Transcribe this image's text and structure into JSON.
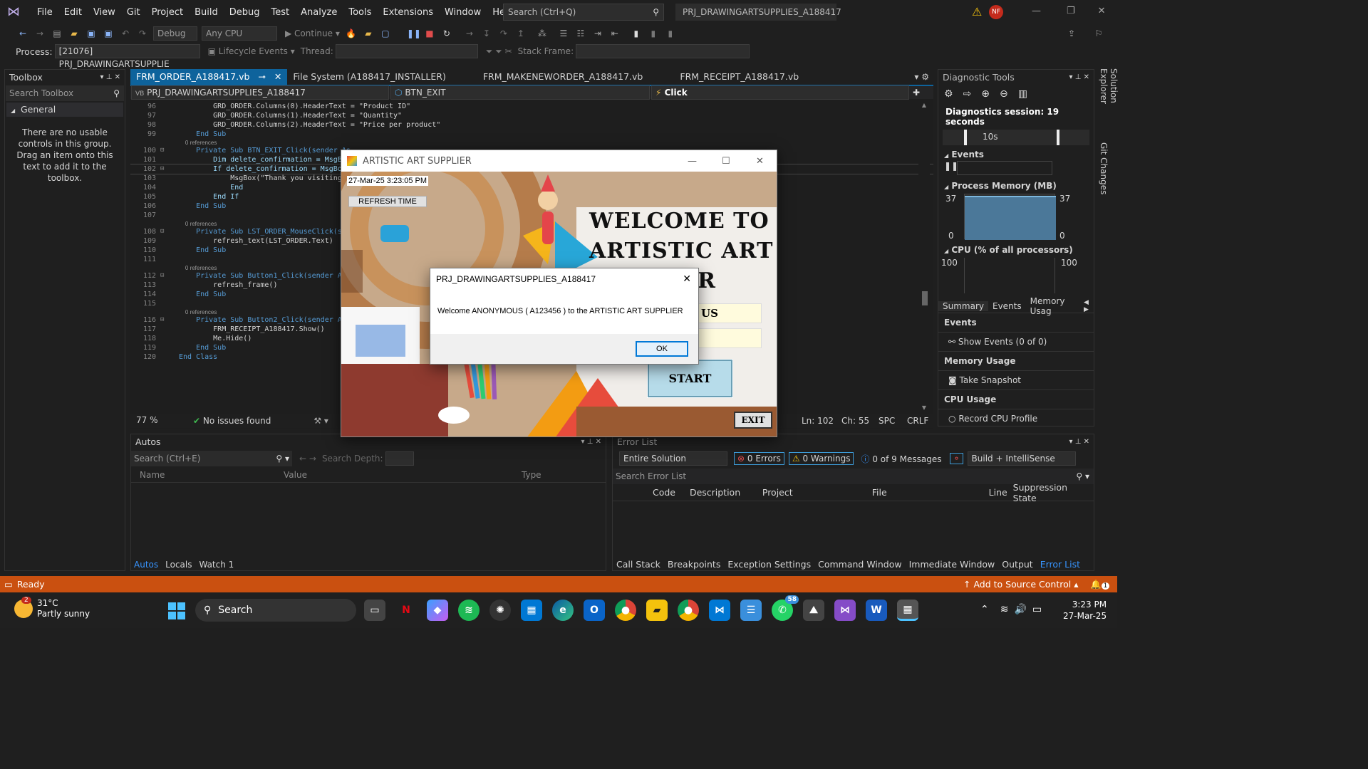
{
  "menu": [
    "File",
    "Edit",
    "View",
    "Git",
    "Project",
    "Build",
    "Debug",
    "Test",
    "Analyze",
    "Tools",
    "Extensions",
    "Window",
    "Help"
  ],
  "search": {
    "placeholder": "Search (Ctrl+Q)"
  },
  "solution_title": "PRJ_DRAWINGARTSUPPLIES_A188417",
  "user_initials": "NF",
  "toolbar": {
    "config": "Debug",
    "platform": "Any CPU",
    "continue": "Continue"
  },
  "toolbar2": {
    "process_label": "Process:",
    "process_value": "[21076] PRJ_DRAWINGARTSUPPLIE",
    "lifecycle": "Lifecycle Events",
    "thread": "Thread:",
    "stackframe": "Stack Frame:"
  },
  "toolbox": {
    "title": "Toolbox",
    "search": "Search Toolbox",
    "group": "General",
    "empty": "There are no usable controls in this group. Drag an item onto this text to add it to the toolbox."
  },
  "tabs": [
    "FRM_ORDER_A188417.vb",
    "File System (A188417_INSTALLER)",
    "FRM_MAKENEWORDER_A188417.vb",
    "FRM_RECEIPT_A188417.vb"
  ],
  "nav": {
    "project": "PRJ_DRAWINGARTSUPPLIES_A188417",
    "object": "BTN_EXIT",
    "event": "Click"
  },
  "code": [
    {
      "n": "96",
      "t": "        GRD_ORDER.Columns(0).HeaderText = \"Product ID\""
    },
    {
      "n": "97",
      "t": "        GRD_ORDER.Columns(1).HeaderText = \"Quantity\""
    },
    {
      "n": "98",
      "t": "        GRD_ORDER.Columns(2).HeaderText = \"Price per product\""
    },
    {
      "n": "99",
      "t": "    End Sub"
    },
    {
      "n": "",
      "t": "    0 references",
      "ref": true
    },
    {
      "n": "100",
      "t": "    Private Sub BTN_EXIT_Click(sender As"
    },
    {
      "n": "101",
      "t": "        Dim delete_confirmation = MsgBox"
    },
    {
      "n": "102",
      "t": "        If delete_confirmation = MsgBoxR"
    },
    {
      "n": "103",
      "t": "            MsgBox(\"Thank you visiting A"
    },
    {
      "n": "104",
      "t": "            End"
    },
    {
      "n": "105",
      "t": "        End If"
    },
    {
      "n": "106",
      "t": "    End Sub"
    },
    {
      "n": "107",
      "t": ""
    },
    {
      "n": "",
      "t": "    0 references",
      "ref": true
    },
    {
      "n": "108",
      "t": "    Private Sub LST_ORDER_MouseClick(ser"
    },
    {
      "n": "109",
      "t": "        refresh_text(LST_ORDER.Text)"
    },
    {
      "n": "110",
      "t": "    End Sub"
    },
    {
      "n": "111",
      "t": ""
    },
    {
      "n": "",
      "t": "    0 references",
      "ref": true
    },
    {
      "n": "112",
      "t": "    Private Sub Button1_Click(sender As"
    },
    {
      "n": "113",
      "t": "        refresh_frame()"
    },
    {
      "n": "114",
      "t": "    End Sub"
    },
    {
      "n": "115",
      "t": ""
    },
    {
      "n": "",
      "t": "    0 references",
      "ref": true
    },
    {
      "n": "116",
      "t": "    Private Sub Button2_Click(sender As"
    },
    {
      "n": "117",
      "t": "        FRM_RECEIPT_A188417.Show()"
    },
    {
      "n": "118",
      "t": "        Me.Hide()"
    },
    {
      "n": "119",
      "t": "    End Sub"
    },
    {
      "n": "120",
      "t": "End Class"
    }
  ],
  "editor_status": {
    "zoom": "77 %",
    "issues": "No issues found",
    "ln": "Ln: 102",
    "ch": "Ch: 55",
    "spc": "SPC",
    "crlf": "CRLF"
  },
  "diag": {
    "title": "Diagnostic Tools",
    "session": "Diagnostics session: 19 seconds",
    "time_tick": "10s",
    "events": "Events",
    "memory": "Process Memory (MB)",
    "mem_max": "37",
    "mem_min": "0",
    "cpu": "CPU (% of all processors)",
    "cpu_max": "100",
    "tabs": [
      "Summary",
      "Events",
      "Memory Usag"
    ],
    "events_h": "Events",
    "show_events": "Show Events (0 of 0)",
    "mem_h": "Memory Usage",
    "snapshot": "Take Snapshot",
    "cpu_h": "CPU Usage",
    "record": "Record CPU Profile"
  },
  "side_tabs": [
    "Solution Explorer",
    "Git Changes"
  ],
  "autos": {
    "title": "Autos",
    "search": "Search (Ctrl+E)",
    "depth": "Search Depth:",
    "cols": [
      "Name",
      "Value",
      "Type"
    ],
    "tabs": [
      "Autos",
      "Locals",
      "Watch 1"
    ]
  },
  "errlist": {
    "title": "Error List",
    "scope": "Entire Solution",
    "errors": "0 Errors",
    "warnings": "0 Warnings",
    "messages": "0 of 9 Messages",
    "build": "Build + IntelliSense",
    "search": "Search Error List",
    "cols": [
      "Code",
      "Description",
      "Project",
      "File",
      "Line",
      "Suppression State"
    ],
    "bottom_tabs": [
      "Call Stack",
      "Breakpoints",
      "Exception Settings",
      "Command Window",
      "Immediate Window",
      "Output",
      "Error List"
    ]
  },
  "status": {
    "ready": "Ready",
    "source": "Add to Source Control"
  },
  "app": {
    "title": "ARTISTIC ART SUPPLIER",
    "datetime": "27-Mar-25 3:23:05 PM",
    "refresh": "REFRESH TIME",
    "welcome1": "WELCOME TO",
    "welcome2": "ARTISTIC ART",
    "welcome3": "R",
    "field1": "US",
    "start": "START",
    "exit": "EXIT"
  },
  "msgbox": {
    "title": "PRJ_DRAWINGARTSUPPLIES_A188417",
    "text": "Welcome ANONYMOUS ( A123456 ) to the ARTISTIC ART SUPPLIER",
    "ok": "OK"
  },
  "taskbar": {
    "temp": "31°C",
    "weather": "Partly sunny",
    "weather_badge": "2",
    "search": "Search",
    "time": "3:23 PM",
    "date": "27-Mar-25",
    "whatsapp_badge": "58",
    "notif_badge": "1"
  },
  "colors": {
    "accent": "#0e639c",
    "status": "#ca5010",
    "vs_purple": "#854cc7"
  }
}
